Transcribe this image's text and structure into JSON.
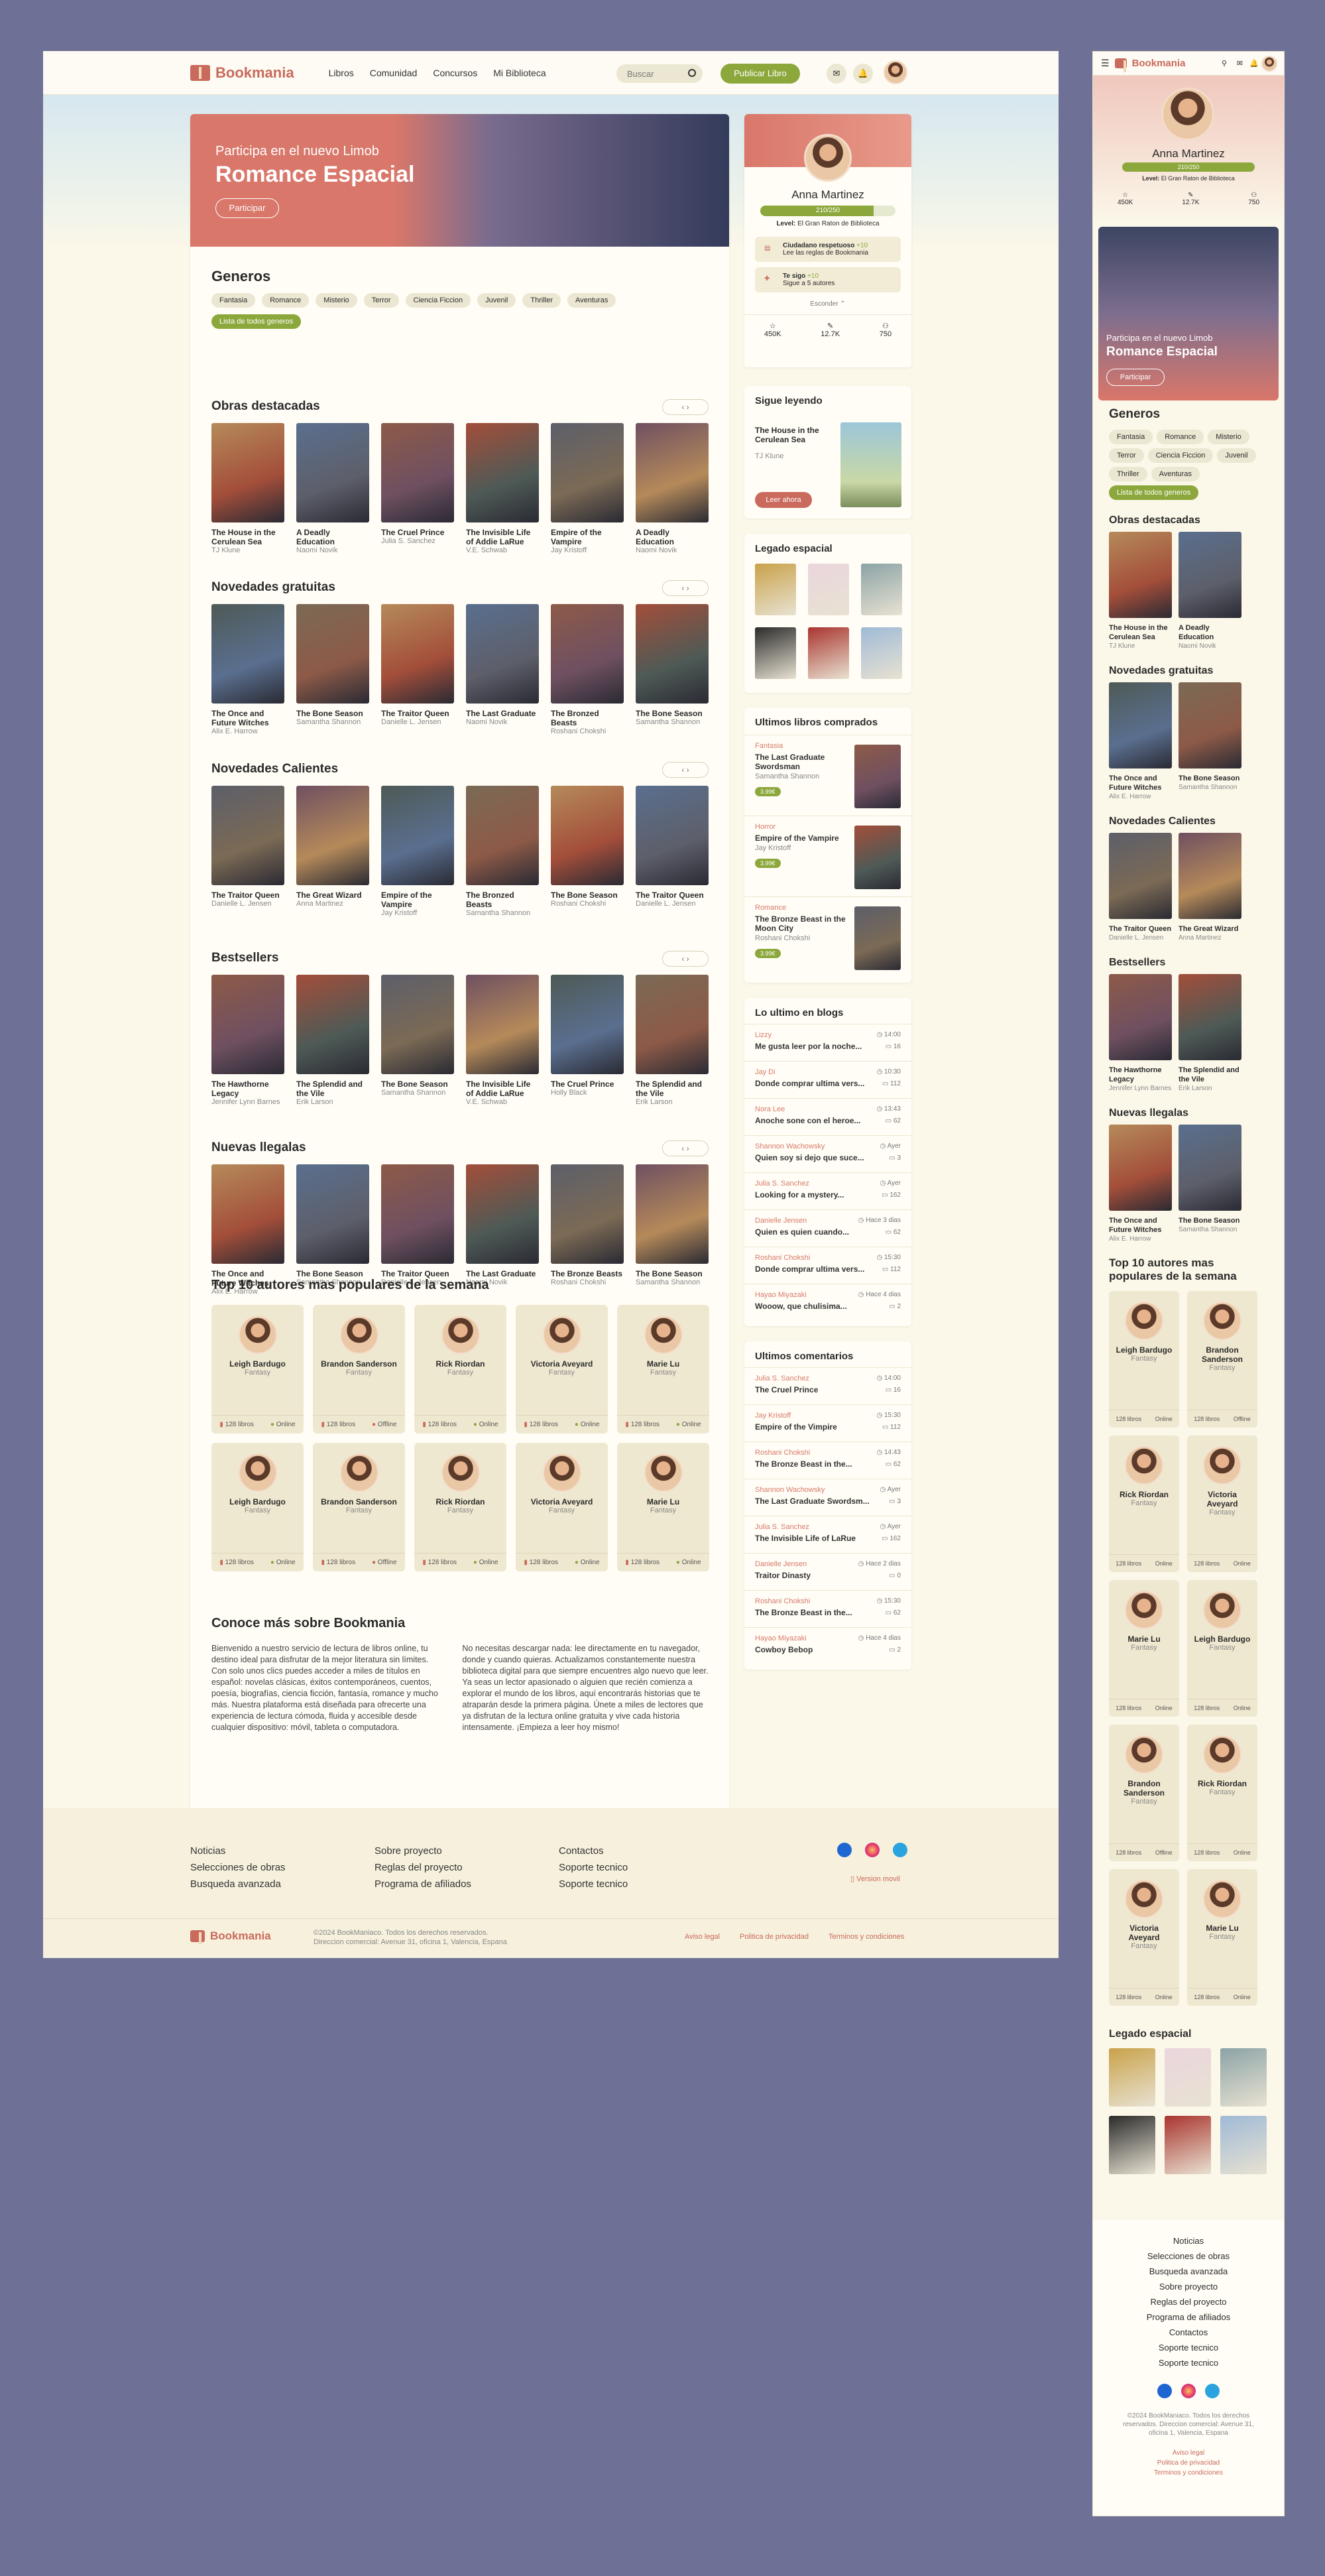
{
  "brand": {
    "name": "Bookmania",
    "accent": "#c96a5c",
    "green": "#8ca83c"
  },
  "nav": {
    "items": [
      "Libros",
      "Comunidad",
      "Concursos",
      "Mi Biblioteca"
    ],
    "search_placeholder": "Buscar",
    "publish": "Publicar Libro"
  },
  "hero": {
    "subtitle": "Participa en el nuevo Limob",
    "title": "Romance Espacial",
    "button": "Participar"
  },
  "genres": {
    "title": "Generos",
    "items": [
      "Fantasia",
      "Romance",
      "Misterio",
      "Terror",
      "Ciencia Ficcion",
      "Juvenil",
      "Thriller",
      "Aventuras"
    ],
    "list": "Lista de todos generos"
  },
  "shelves": [
    {
      "title": "Obras destacadas",
      "books": [
        [
          "The House in the Cerulean Sea",
          "TJ Klune"
        ],
        [
          "A Deadly Education",
          "Naomi Novik"
        ],
        [
          "The Cruel Prince",
          "Julia S. Sanchez"
        ],
        [
          "The Invisible Life of Addie LaRue",
          "V.E. Schwab"
        ],
        [
          "Empire of the Vampire",
          "Jay Kristoff"
        ],
        [
          "A Deadly Education",
          "Naomi Novik"
        ]
      ]
    },
    {
      "title": "Novedades gratuitas",
      "books": [
        [
          "The Once and Future Witches",
          "Alix E. Harrow"
        ],
        [
          "The Bone Season",
          "Samantha Shannon"
        ],
        [
          "The Traitor Queen",
          "Danielle L. Jensen"
        ],
        [
          "The Last Graduate",
          "Naomi Novik"
        ],
        [
          "The Bronzed Beasts",
          "Roshani Chokshi"
        ],
        [
          "The Bone Season",
          "Samantha Shannon"
        ]
      ]
    },
    {
      "title": "Novedades Calientes",
      "books": [
        [
          "The Traitor Queen",
          "Danielle L. Jensen"
        ],
        [
          "The Great Wizard",
          "Anna Martinez"
        ],
        [
          "Empire of the Vampire",
          "Jay Kristoff"
        ],
        [
          "The Bronzed Beasts",
          "Samantha Shannon"
        ],
        [
          "The Bone Season",
          "Roshani Chokshi"
        ],
        [
          "The Traitor Queen",
          "Danielle L. Jensen"
        ]
      ]
    },
    {
      "title": "Bestsellers",
      "books": [
        [
          "The Hawthorne Legacy",
          "Jennifer Lynn Barnes"
        ],
        [
          "The Splendid and the Vile",
          "Erik Larson"
        ],
        [
          "The Bone Season",
          "Samantha Shannon"
        ],
        [
          "The Invisible Life of Addie LaRue",
          "V.E. Schwab"
        ],
        [
          "The Cruel Prince",
          "Holly Black"
        ],
        [
          "The Splendid and the Vile",
          "Erik Larson"
        ]
      ]
    },
    {
      "title": "Nuevas llegalas",
      "books": [
        [
          "The Once and Future Witches",
          "Alix E. Harrow"
        ],
        [
          "The Bone Season",
          "Samantha Shannon"
        ],
        [
          "The Traitor Queen",
          "Danielle L. Jensen"
        ],
        [
          "The Last Graduate",
          "Naomi Novik"
        ],
        [
          "The Bronze Beasts",
          "Roshani Chokshi"
        ],
        [
          "The Bone Season",
          "Samantha Shannon"
        ]
      ]
    }
  ],
  "top_authors": {
    "title": "Top 10 autores mas populares de la semana",
    "books_label": "128 libros",
    "authors": [
      [
        "Leigh Bardugo",
        "Fantasy",
        "Online"
      ],
      [
        "Brandon Sanderson",
        "Fantasy",
        "Offline"
      ],
      [
        "Rick Riordan",
        "Fantasy",
        "Online"
      ],
      [
        "Victoria Aveyard",
        "Fantasy",
        "Online"
      ],
      [
        "Marie Lu",
        "Fantasy",
        "Online"
      ],
      [
        "Leigh Bardugo",
        "Fantasy",
        "Online"
      ],
      [
        "Brandon Sanderson",
        "Fantasy",
        "Offline"
      ],
      [
        "Rick Riordan",
        "Fantasy",
        "Online"
      ],
      [
        "Victoria Aveyard",
        "Fantasy",
        "Online"
      ],
      [
        "Marie Lu",
        "Fantasy",
        "Online"
      ]
    ]
  },
  "about": {
    "title": "Conoce más sobre Bookmania",
    "col1": "Bienvenido a nuestro servicio de lectura de libros online, tu destino ideal para disfrutar de la mejor literatura sin límites. Con solo unos clics puedes acceder a miles de títulos en español: novelas clásicas, éxitos contemporáneos, cuentos, poesía, biografías, ciencia ficción, fantasía, romance y mucho más. Nuestra plataforma está diseñada para ofrecerte una experiencia de lectura cómoda, fluida y accesible desde cualquier dispositivo: móvil, tableta o computadora.",
    "col2": "No necesitas descargar nada: lee directamente en tu navegador, donde y cuando quieras. Actualizamos constantemente nuestra biblioteca digital para que siempre encuentres algo nuevo que leer. Ya seas un lector apasionado o alguien que recién comienza a explorar el mundo de los libros, aquí encontrarás historias que te atraparán desde la primera página. Únete a miles de lectores que ya disfrutan de la lectura online gratuita y vive cada historia intensamente. ¡Empieza a leer hoy mismo!"
  },
  "profile": {
    "name": "Anna Martinez",
    "xp": "210/250",
    "xp_fraction": 0.84,
    "level_label": "Level:",
    "level": "El Gran Raton de Biblioteca",
    "tasks": [
      [
        "Ciudadano respetuoso",
        "+10",
        "Lee las reglas de Bookmania"
      ],
      [
        "Te sigo",
        "+10",
        "Sigue a 5 autores"
      ]
    ],
    "hide": "Esconder",
    "stats": [
      "450K",
      "12.7K",
      "750"
    ]
  },
  "continue": {
    "title": "Sigue leyendo",
    "book": "The House in the Cerulean Sea",
    "author": "TJ Klune",
    "button": "Leer ahora"
  },
  "legacy": {
    "title": "Legado espacial"
  },
  "purchased": {
    "title": "Ultimos libros comprados",
    "items": [
      [
        "Fantasia",
        "The Last Graduate Swordsman",
        "Samantha Shannon",
        "3.99€"
      ],
      [
        "Horror",
        "Empire of the Vampire",
        "Jay Kristoff",
        "3.99€"
      ],
      [
        "Romance",
        "The Bronze Beast in the Moon City",
        "Roshani Chokshi",
        "3.99€"
      ]
    ]
  },
  "blogs": {
    "title": "Lo ultimo en blogs",
    "items": [
      [
        "Lizzy",
        "Me gusta leer por la noche...",
        "14:00",
        "16"
      ],
      [
        "Jay Di",
        "Donde comprar ultima vers...",
        "10:30",
        "112"
      ],
      [
        "Nora Lee",
        "Anoche sone con el heroe...",
        "13:43",
        "62"
      ],
      [
        "Shannon Wachowsky",
        "Quien soy si dejo que suce...",
        "Ayer",
        "3"
      ],
      [
        "Julia S. Sanchez",
        "Looking for a mystery...",
        "Ayer",
        "162"
      ],
      [
        "Danielle Jensen",
        "Quien es quien cuando...",
        "Hace 3 dias",
        "62"
      ],
      [
        "Roshani Chokshi",
        "Donde comprar ultima vers...",
        "15:30",
        "112"
      ],
      [
        "Hayao Miyazaki",
        "Wooow, que chulisima...",
        "Hace 4 dias",
        "2"
      ]
    ]
  },
  "comments": {
    "title": "Ultimos comentarios",
    "items": [
      [
        "Julia S. Sanchez",
        "The Cruel Prince",
        "14:00",
        "16"
      ],
      [
        "Jay Kristoff",
        "Empire of the Vimpire",
        "15:30",
        "112"
      ],
      [
        "Roshani Chokshi",
        "The Bronze Beast in the...",
        "14:43",
        "62"
      ],
      [
        "Shannon Wachowsky",
        "The Last Graduate Swordsm...",
        "Ayer",
        "3"
      ],
      [
        "Julia S. Sanchez",
        "The Invisible Life of LaRue",
        "Ayer",
        "162"
      ],
      [
        "Danielle Jensen",
        "Traitor Dinasty",
        "Hace 2 dias",
        "0"
      ],
      [
        "Roshani Chokshi",
        "The Bronze Beast in the...",
        "15:30",
        "62"
      ],
      [
        "Hayao Miyazaki",
        "Cowboy Bebop",
        "Hace 4 dias",
        "2"
      ]
    ]
  },
  "footer": {
    "col1": [
      "Noticias",
      "Selecciones de obras",
      "Busqueda avanzada"
    ],
    "col2": [
      "Sobre proyecto",
      "Reglas del proyecto",
      "Programa de afiliados"
    ],
    "col3": [
      "Contactos",
      "Soporte tecnico",
      "Soporte tecnico"
    ],
    "mobile_version": "Version movil",
    "copyright": "©2024 BookManiaco. Todos los derechos reservados.",
    "address": "Direccion comercial: Avenue 31, oficina 1, Valencia, Espana",
    "links": [
      "Aviso legal",
      "Politica de privacidad",
      "Terminos y condiciones"
    ]
  },
  "mobile": {
    "hero_subtitle": "Participa en el nuevo Limob",
    "hero_title": "Romance Espacial",
    "hero_button": "Participar",
    "genres_title": "Generos",
    "shelves": [
      "Obras destacadas",
      "Novedades gratuitas",
      "Novedades Calientes",
      "Bestsellers",
      "Nuevas llegalas"
    ],
    "top_title": "Top 10 autores mas populares de la semana",
    "legacy_title": "Legado espacial",
    "footer_links": [
      "Noticias",
      "Selecciones de obras",
      "Busqueda avanzada",
      "Sobre proyecto",
      "Reglas del proyecto",
      "Programa de afiliados",
      "Contactos",
      "Soporte tecnico",
      "Soporte tecnico"
    ],
    "copyright": "©2024 BookManiaco. Todos los derechos reservados. Direccion comercial: Avenue 31, oficina 1, Valencia, Espana",
    "legal": [
      "Aviso legal",
      "Politica de privacidad",
      "Terminos y condiciones"
    ]
  }
}
